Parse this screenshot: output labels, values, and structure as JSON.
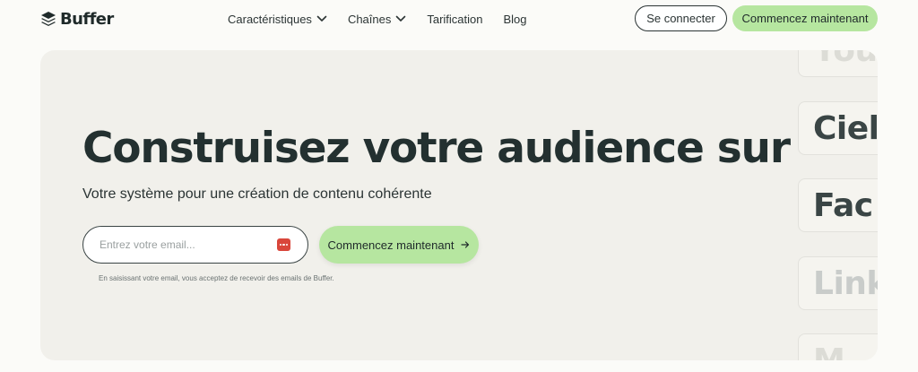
{
  "nav": {
    "logo_text": "Buffer",
    "menu": [
      {
        "label": "Caractéristiques",
        "has_dropdown": true
      },
      {
        "label": "Chaînes",
        "has_dropdown": true
      },
      {
        "label": "Tarification",
        "has_dropdown": false
      },
      {
        "label": "Blog",
        "has_dropdown": false
      }
    ],
    "login_label": "Se connecter",
    "start_label": "Commencez maintenant"
  },
  "hero": {
    "headline": "Construisez votre audience sur",
    "subtitle": "Votre système pour une création de contenu cohérente",
    "email_placeholder": "Entrez votre email...",
    "cta_label": "Commencez maintenant",
    "disclaimer": "En saisissant votre email, vous acceptez de recevoir des emails de Buffer.",
    "channels": [
      "You",
      "Ciel",
      "Fac",
      "Link",
      "M"
    ]
  },
  "colors": {
    "accent_green": "#b6e6a0",
    "hero_bg": "#f1f0eb",
    "page_bg": "#fbfbf8",
    "text_dark": "#233030",
    "password_icon": "#d9463b"
  },
  "icons": {
    "logo": "buffer-stack-icon",
    "dropdown": "chevron-down-icon",
    "cta_arrow": "arrow-right-icon",
    "field_addon": "password-manager-icon"
  }
}
